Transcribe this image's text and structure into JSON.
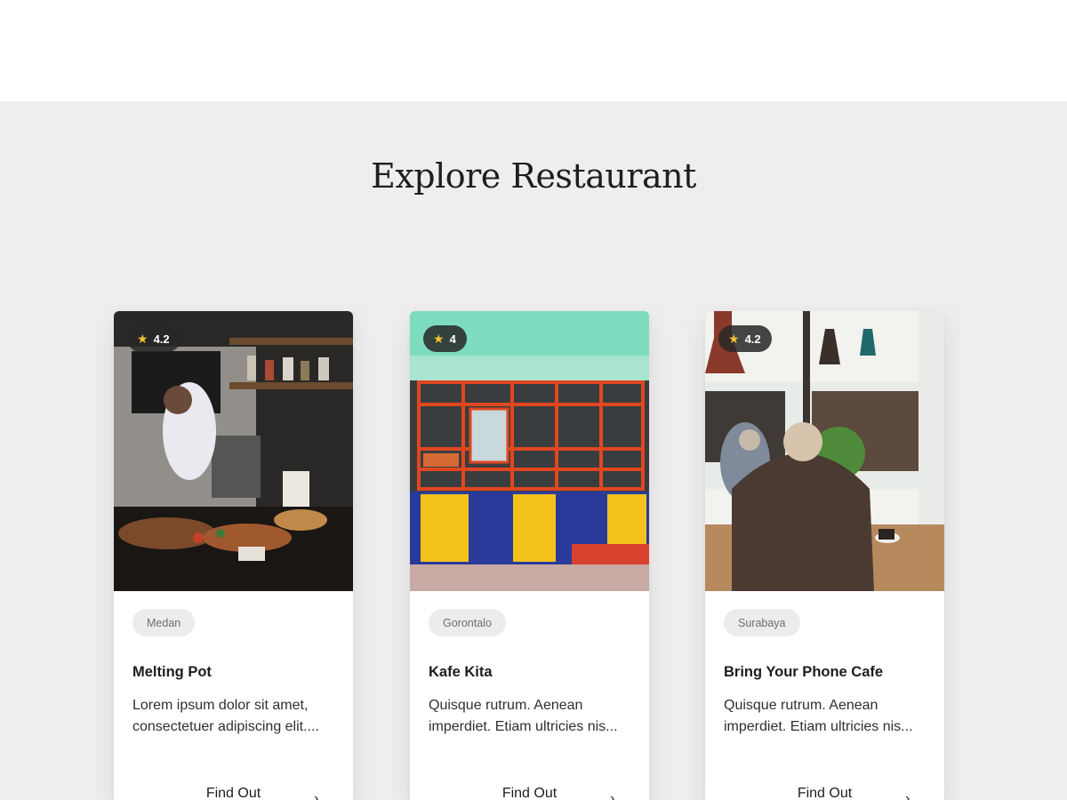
{
  "section": {
    "title": "Explore Restaurant"
  },
  "restaurants": [
    {
      "rating": "4.2",
      "city": "Medan",
      "name": "Melting Pot",
      "description_lines": [
        "Lorem ipsum dolor sit amet,",
        "consectetuer adipiscing elit...."
      ],
      "cta": "Find Out",
      "image": "cafe-counter-photo"
    },
    {
      "rating": "4",
      "city": "Gorontalo",
      "name": "Kafe Kita",
      "description_lines": [
        "Quisque rutrum. Aenean",
        "imperdiet. Etiam ultricies nis..."
      ],
      "cta": "Find Out",
      "image": "colorful-storefront-photo"
    },
    {
      "rating": "4.2",
      "city": "Surabaya",
      "name": "Bring Your Phone Cafe",
      "description_lines": [
        "Quisque rutrum. Aenean",
        "imperdiet. Etiam ultricies nis..."
      ],
      "cta": "Find Out",
      "image": "cafe-interior-photo"
    }
  ],
  "icons": {
    "rating": "star-icon",
    "cta": "chevron-right-icon"
  },
  "colors": {
    "star": "#f4c430",
    "section_bg": "#eeeeee",
    "badge_bg": "#ececec"
  }
}
